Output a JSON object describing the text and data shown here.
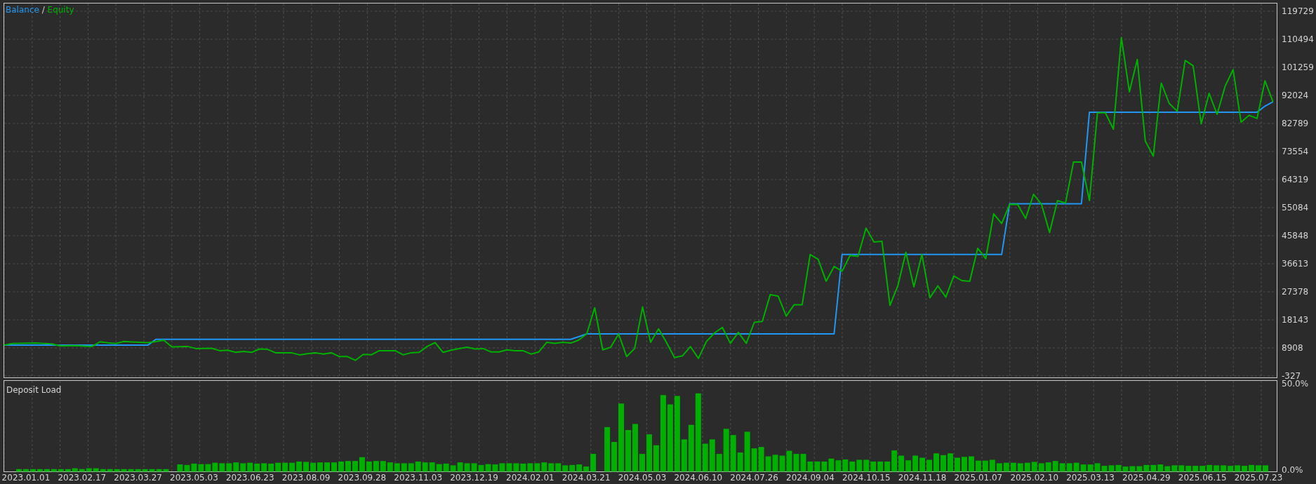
{
  "equity_panel": {
    "legend_separator": "/",
    "chart_data": {
      "type": "line",
      "grid": true,
      "ylim": [
        -327,
        119729
      ],
      "yticks": [
        119729,
        110494,
        101259,
        92024,
        82789,
        73554,
        64319,
        55084,
        45848,
        36613,
        27378,
        18143,
        8908,
        -327
      ],
      "categories": [
        null,
        null,
        null,
        null,
        null,
        null,
        null,
        null,
        null,
        null,
        null,
        null,
        null,
        null,
        null,
        null,
        null,
        null,
        null,
        null,
        null,
        null,
        null,
        null,
        null,
        null,
        null,
        null,
        null,
        null,
        null,
        null,
        null,
        null,
        null,
        null,
        null,
        null,
        null,
        null,
        null,
        null,
        null,
        null,
        null,
        null,
        null,
        null,
        null,
        null,
        null,
        null,
        null,
        null,
        null,
        null,
        null,
        null,
        null,
        null,
        null,
        null,
        null,
        null,
        null,
        null,
        null,
        null,
        null,
        null,
        null,
        null,
        null,
        null,
        null,
        null,
        null,
        null,
        null,
        null,
        null,
        null,
        null,
        null,
        null,
        null,
        null,
        null,
        null,
        null,
        null,
        null,
        null,
        null,
        null,
        null,
        null,
        null,
        null,
        null,
        null,
        null,
        null,
        null,
        null,
        null,
        null,
        null,
        null,
        null,
        null,
        null,
        null,
        null,
        null,
        null,
        null,
        null,
        null,
        null,
        null,
        null,
        null,
        null,
        null,
        null,
        null,
        null,
        null,
        null,
        null,
        null,
        null,
        null,
        null,
        null,
        null,
        null,
        null,
        null,
        null,
        null,
        null,
        null,
        null,
        null,
        null,
        null,
        null,
        null,
        null,
        null,
        null,
        null,
        null,
        null,
        null,
        null,
        null,
        null
      ],
      "series": [
        {
          "name": "Balance",
          "color": "#2196f3",
          "values": [
            9800,
            9800,
            9800,
            9800,
            9800,
            9800,
            9800,
            9800,
            9800,
            9800,
            9800,
            9800,
            9800,
            9800,
            9800,
            9800,
            9800,
            9800,
            9800,
            11740,
            11740,
            11740,
            11740,
            11740,
            11740,
            11740,
            11740,
            11740,
            11740,
            11740,
            11740,
            11740,
            11740,
            11740,
            11740,
            11740,
            11740,
            11740,
            11740,
            11740,
            11740,
            11740,
            11740,
            11740,
            11740,
            11740,
            11740,
            11740,
            11740,
            11740,
            11740,
            11740,
            11740,
            11740,
            11740,
            11740,
            11740,
            11740,
            11740,
            11740,
            11740,
            11740,
            11740,
            11740,
            11740,
            11740,
            11740,
            11740,
            11740,
            11740,
            11740,
            11740,
            12600,
            13535,
            13535,
            13535,
            13535,
            13535,
            13535,
            13535,
            13535,
            13535,
            13535,
            13535,
            13535,
            13535,
            13535,
            13535,
            13535,
            13535,
            13535,
            13535,
            13535,
            13535,
            13535,
            13535,
            13535,
            13535,
            13535,
            13535,
            13535,
            13535,
            13535,
            13535,
            13535,
            39650,
            39650,
            39650,
            39650,
            39650,
            39650,
            39650,
            39650,
            39650,
            39650,
            39650,
            39650,
            39650,
            39650,
            39650,
            39650,
            39650,
            39650,
            39650,
            39650,
            39650,
            56360,
            56360,
            56360,
            56360,
            56360,
            56360,
            56360,
            56360,
            56360,
            56360,
            86500,
            86500,
            86500,
            86500,
            86500,
            86500,
            86500,
            86500,
            86500,
            86500,
            86500,
            86500,
            86500,
            86500,
            86500,
            86500,
            86500,
            86500,
            86500,
            86500,
            86500,
            86500,
            88500,
            89900
          ]
        },
        {
          "name": "Equity",
          "color": "#00b000",
          "values": [
            9800,
            10354,
            10400,
            10450,
            10492,
            10350,
            10215,
            9523,
            9600,
            9662,
            9500,
            9385,
            10908,
            10600,
            10354,
            11046,
            10900,
            10769,
            10631,
            11000,
            11461,
            9247,
            9300,
            9385,
            8693,
            8750,
            8800,
            8001,
            8139,
            7447,
            7724,
            7447,
            8555,
            8416,
            7309,
            7309,
            7309,
            6617,
            7000,
            7309,
            6894,
            7309,
            6063,
            6063,
            4818,
            6755,
            6650,
            8001,
            8001,
            8001,
            6617,
            7309,
            7447,
            9385,
            10631,
            7447,
            8139,
            8700,
            9108,
            8555,
            8693,
            7585,
            7585,
            8278,
            8001,
            8001,
            6894,
            7585,
            10769,
            10400,
            10769,
            10492,
            11500,
            13537,
            22118,
            8278,
            9108,
            13537,
            6063,
            8693,
            22395,
            10769,
            15198,
            10709,
            5741,
            6293,
            9329,
            5465,
            11000,
            13800,
            15677,
            10433,
            14021,
            10433,
            17333,
            17609,
            26441,
            25920,
            19400,
            23140,
            23140,
            39650,
            38100,
            30870,
            35720,
            34170,
            39340,
            39030,
            48315,
            43770,
            43980,
            22930,
            29430,
            40370,
            29020,
            39650,
            25400,
            29330,
            25610,
            32630,
            31080,
            30870,
            41710,
            38300,
            53060,
            49860,
            56150,
            56150,
            51500,
            59460,
            56150,
            46870,
            57400,
            56580,
            70090,
            70090,
            57400,
            86300,
            86300,
            80930,
            111060,
            93200,
            103840,
            77000,
            72050,
            96090,
            89380,
            86810,
            103530,
            101770,
            82640,
            92690,
            85780,
            95050,
            100530,
            83200,
            85470,
            84430,
            96820,
            89900
          ]
        }
      ]
    }
  },
  "deposit_panel": {
    "chart_data": {
      "type": "bar",
      "title": "Deposit Load",
      "grid": true,
      "ylim": [
        0,
        52.7
      ],
      "yticks": [
        {
          "value": 50,
          "label": "50.0%"
        },
        {
          "value": 0,
          "label": "0.0%"
        }
      ],
      "categories": [
        null,
        "2023.01.01",
        null,
        null,
        null,
        null,
        null,
        null,
        null,
        "2023.02.17",
        null,
        null,
        null,
        null,
        null,
        null,
        null,
        "2023.03.27",
        null,
        null,
        null,
        null,
        null,
        null,
        null,
        "2023.05.03",
        null,
        null,
        null,
        null,
        null,
        null,
        null,
        "2023.06.23",
        null,
        null,
        null,
        null,
        null,
        null,
        null,
        "2023.08.09",
        null,
        null,
        null,
        null,
        null,
        null,
        null,
        "2023.09.28",
        null,
        null,
        null,
        null,
        null,
        null,
        null,
        "2023.11.03",
        null,
        null,
        null,
        null,
        null,
        null,
        null,
        "2023.12.19",
        null,
        null,
        null,
        null,
        null,
        null,
        null,
        "2024.02.01",
        null,
        null,
        null,
        null,
        null,
        null,
        null,
        "2024.03.21",
        null,
        null,
        null,
        null,
        null,
        null,
        null,
        "2024.05.03",
        null,
        null,
        null,
        null,
        null,
        null,
        null,
        "2024.06.10",
        null,
        null,
        null,
        null,
        null,
        null,
        null,
        "2024.07.26",
        null,
        null,
        null,
        null,
        null,
        null,
        null,
        "2024.09.04",
        null,
        null,
        null,
        null,
        null,
        null,
        null,
        "2024.10.15",
        null,
        null,
        null,
        null,
        null,
        null,
        null,
        "2024.11.18",
        null,
        null,
        null,
        null,
        null,
        null,
        null,
        "2025.01.07",
        null,
        null,
        null,
        null,
        null,
        null,
        null,
        "2025.02.10",
        null,
        null,
        null,
        null,
        null,
        null,
        null,
        "2025.03.13",
        null,
        null,
        null,
        null,
        null,
        null,
        null,
        "2025.04.29",
        null,
        null,
        null,
        null,
        null,
        null,
        null,
        "2025.06.15",
        null,
        null,
        null,
        null,
        null,
        null,
        null,
        "2025.07.23",
        null
      ],
      "series": [
        {
          "color": "#00b000",
          "values": [
            1.5,
            1.5,
            1.5,
            1.5,
            1.5,
            1.5,
            1.5,
            1.5,
            2.0,
            1.5,
            2.0,
            2.0,
            1.5,
            1.5,
            1.5,
            1.5,
            1.5,
            1.5,
            1.5,
            1.5,
            1.5,
            1.5,
            0,
            4.2,
            3.9,
            4.7,
            4.4,
            4.4,
            5.2,
            4.9,
            4.9,
            5.4,
            4.9,
            5.2,
            4.7,
            4.9,
            4.7,
            5.2,
            5.2,
            5.2,
            5.9,
            5.7,
            5.2,
            5.4,
            5.4,
            5.4,
            5.9,
            6.2,
            6.2,
            8.4,
            5.9,
            6.2,
            6.2,
            5.4,
            4.9,
            4.9,
            4.9,
            5.9,
            5.4,
            5.4,
            4.4,
            4.7,
            3.7,
            5.4,
            4.9,
            4.9,
            3.9,
            4.4,
            4.2,
            4.9,
            4.9,
            4.9,
            4.7,
            4.9,
            4.9,
            5.4,
            4.9,
            4.9,
            3.7,
            3.9,
            4.2,
            3.0,
            10.3,
            0,
            25.8,
            17.2,
            39.4,
            24.1,
            27.6,
            10.3,
            21.6,
            15.3,
            44.3,
            38.9,
            43.8,
            18.7,
            27.1,
            45.3,
            16.2,
            18.7,
            10.3,
            24.8,
            21.2,
            11.1,
            23.1,
            13.5,
            14.3,
            8.9,
            9.8,
            9.3,
            12.1,
            10.3,
            10.3,
            5.9,
            5.9,
            5.9,
            7.6,
            6.6,
            7.1,
            5.9,
            6.9,
            6.9,
            5.9,
            5.9,
            5.9,
            12.3,
            9.3,
            6.6,
            9.3,
            8.1,
            6.9,
            10.6,
            9.6,
            10.6,
            8.1,
            8.6,
            8.9,
            6.4,
            6.4,
            6.9,
            4.9,
            5.2,
            5.2,
            4.9,
            5.2,
            5.7,
            4.9,
            5.4,
            6.2,
            4.9,
            4.9,
            5.2,
            4.2,
            4.2,
            4.9,
            3.4,
            3.7,
            3.9,
            3.0,
            3.2,
            3.2,
            3.9,
            3.9,
            4.2,
            3.2,
            3.7,
            3.7,
            3.4,
            3.4,
            3.4,
            3.9,
            3.7,
            3.7,
            3.4,
            3.7,
            3.4,
            3.9,
            3.7,
            3.7
          ]
        }
      ]
    }
  }
}
